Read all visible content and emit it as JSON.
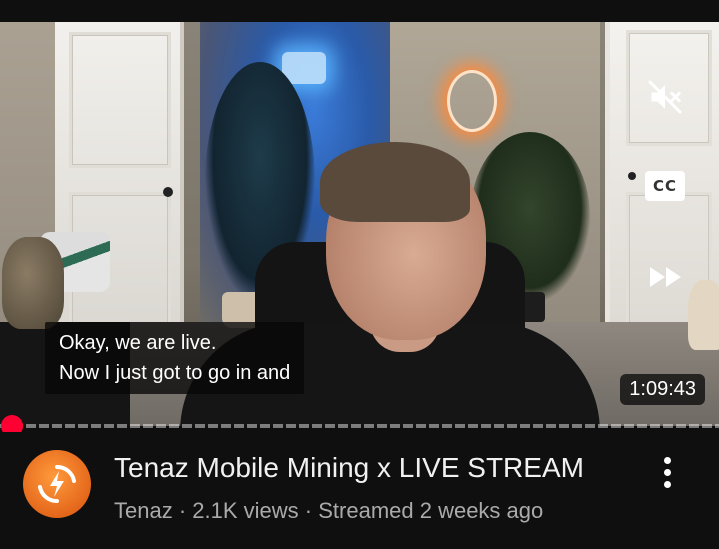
{
  "player": {
    "captions": [
      "Okay, we are live.",
      "Now I just got to go in and"
    ],
    "timestamp": "1:09:43",
    "progress_fraction": 0.01,
    "controls": {
      "cc_label": "CC"
    }
  },
  "video": {
    "title": "Tenaz Mobile Mining x LIVE STREAM",
    "channel": "Tenaz",
    "views": "2.1K views",
    "streamed": "Streamed 2 weeks ago",
    "separator": " · "
  },
  "colors": {
    "background": "#0f0f0f",
    "progress": "#ff0033",
    "avatar": "#e4671b"
  },
  "icons": [
    "mute-icon",
    "closed-captions-icon",
    "fast-forward-icon",
    "more-vertical-icon",
    "channel-logo-icon"
  ]
}
